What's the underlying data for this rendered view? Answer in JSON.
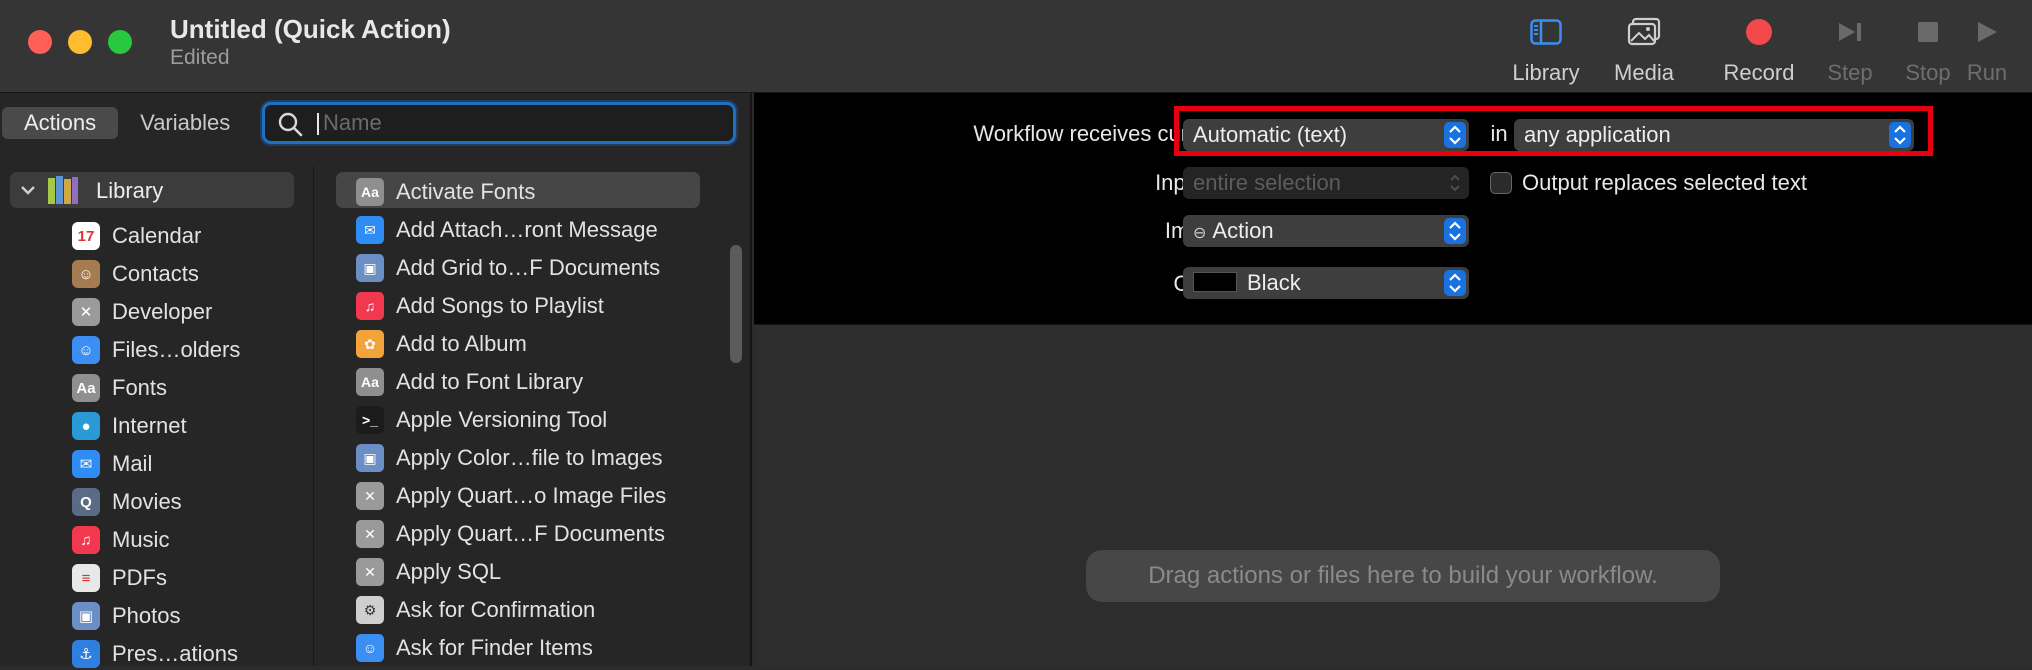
{
  "window": {
    "title": "Untitled (Quick Action)",
    "subtitle": "Edited"
  },
  "toolbar": [
    {
      "label": "Library",
      "icon": "sidebar-icon",
      "enabled": true
    },
    {
      "label": "Media",
      "icon": "photos-icon",
      "enabled": true
    },
    {
      "label": "Record",
      "icon": "record-icon",
      "enabled": true
    },
    {
      "label": "Step",
      "icon": "step-icon",
      "enabled": false
    },
    {
      "label": "Stop",
      "icon": "stop-icon",
      "enabled": false
    },
    {
      "label": "Run",
      "icon": "run-icon",
      "enabled": false
    }
  ],
  "left": {
    "tabs": [
      "Actions",
      "Variables"
    ],
    "active_tab": "Actions",
    "search_placeholder": "Name",
    "search_value": "",
    "library_label": "Library",
    "categories": [
      {
        "label": "Calendar",
        "icon": "calendar-icon",
        "color": "#ffffff"
      },
      {
        "label": "Contacts",
        "icon": "contacts-icon",
        "color": "#a57c4f"
      },
      {
        "label": "Developer",
        "icon": "tools-icon",
        "color": "#9a9a9a"
      },
      {
        "label": "Files…olders",
        "icon": "finder-icon",
        "color": "#3b8ff2"
      },
      {
        "label": "Fonts",
        "icon": "fonts-icon",
        "color": "#8f8f8f"
      },
      {
        "label": "Internet",
        "icon": "globe-icon",
        "color": "#2a9ad6"
      },
      {
        "label": "Mail",
        "icon": "mail-icon",
        "color": "#2f8cf5"
      },
      {
        "label": "Movies",
        "icon": "quicktime-icon",
        "color": "#5a6b86"
      },
      {
        "label": "Music",
        "icon": "music-icon",
        "color": "#f2384e"
      },
      {
        "label": "PDFs",
        "icon": "pdf-icon",
        "color": "#e8e8e8"
      },
      {
        "label": "Photos",
        "icon": "preview-icon",
        "color": "#6b8fc4"
      },
      {
        "label": "Pres…ations",
        "icon": "keynote-icon",
        "color": "#2f7fe0"
      }
    ],
    "actions": [
      {
        "label": "Activate Fonts",
        "icon": "fonts-icon",
        "color": "#8f8f8f"
      },
      {
        "label": "Add Attach…ront Message",
        "icon": "mail-icon",
        "color": "#2f8cf5"
      },
      {
        "label": "Add Grid to…F Documents",
        "icon": "preview-icon",
        "color": "#6b8fc4"
      },
      {
        "label": "Add Songs to Playlist",
        "icon": "music-icon",
        "color": "#f2384e"
      },
      {
        "label": "Add to Album",
        "icon": "photos-app-icon",
        "color": "#f2a43a"
      },
      {
        "label": "Add to Font Library",
        "icon": "fonts-icon",
        "color": "#8f8f8f"
      },
      {
        "label": "Apple Versioning Tool",
        "icon": "terminal-icon",
        "color": "#1b1b1b"
      },
      {
        "label": "Apply Color…file to Images",
        "icon": "preview-icon",
        "color": "#6b8fc4"
      },
      {
        "label": "Apply Quart…o Image Files",
        "icon": "tools-icon",
        "color": "#9a9a9a"
      },
      {
        "label": "Apply Quart…F Documents",
        "icon": "tools-icon",
        "color": "#9a9a9a"
      },
      {
        "label": "Apply SQL",
        "icon": "tools-icon",
        "color": "#9a9a9a"
      },
      {
        "label": "Ask for Confirmation",
        "icon": "automator-icon",
        "color": "#cfcfcf"
      },
      {
        "label": "Ask for Finder Items",
        "icon": "finder-icon",
        "color": "#3b8ff2"
      }
    ]
  },
  "workflow": {
    "receives_label": "Workflow receives current",
    "receives_value": "Automatic (text)",
    "in_label": "in",
    "app_value": "any application",
    "input_label": "Input is",
    "input_value": "entire selection",
    "output_label": "Output replaces selected text",
    "output_checked": false,
    "image_label": "Image",
    "image_value": "Action",
    "color_label": "Color",
    "color_value": "Black",
    "hint": "Drag actions or files here to build your workflow."
  },
  "colors": {
    "accent": "#1a72e0",
    "highlight": "#e8000f"
  }
}
